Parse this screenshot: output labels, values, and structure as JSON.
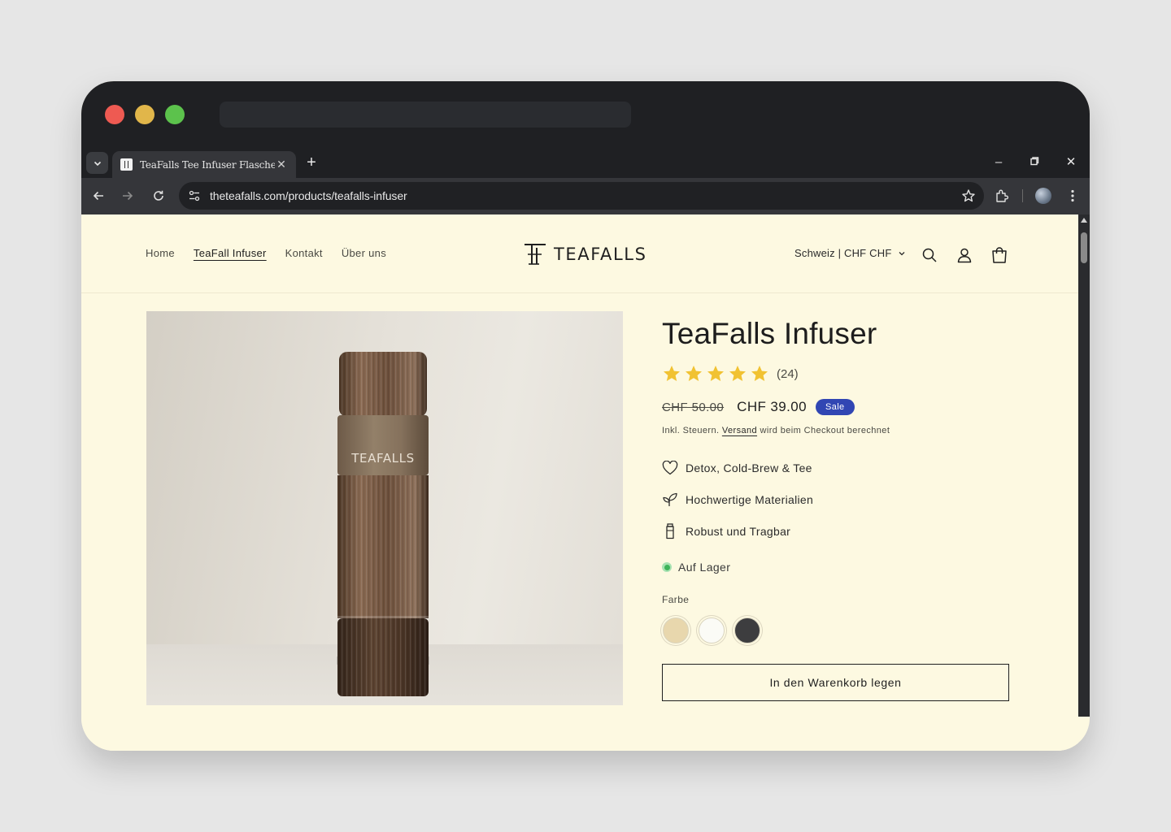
{
  "browser": {
    "tab_title": "TeaFalls Tee Infuser Flasche",
    "url": "theteafalls.com/products/teafalls-infuser"
  },
  "header": {
    "nav": [
      {
        "label": "Home"
      },
      {
        "label": "TeaFall Infuser",
        "active": true
      },
      {
        "label": "Kontakt"
      },
      {
        "label": "Über uns"
      }
    ],
    "logo_text": "TEAFALLS",
    "locale": "Schweiz | CHF CHF",
    "icons": [
      "search-icon",
      "account-icon",
      "cart-icon"
    ]
  },
  "product": {
    "image_brand": "TEAFALLS",
    "title": "TeaFalls Infuser",
    "rating": 5,
    "rating_count": "(24)",
    "old_price": "CHF 50.00",
    "price": "CHF 39.00",
    "badge": "Sale",
    "tax_prefix": "Inkl. Steuern. ",
    "tax_link": "Versand",
    "tax_suffix": " wird beim Checkout berechnet",
    "features": [
      {
        "icon": "heart-icon",
        "label": "Detox, Cold-Brew & Tee"
      },
      {
        "icon": "leaf-icon",
        "label": "Hochwertige Materialien"
      },
      {
        "icon": "bottle-icon",
        "label": "Robust und Tragbar"
      }
    ],
    "stock": "Auf Lager",
    "color_label": "Farbe",
    "colors": [
      "#e8d7ad",
      "#fbfbf6",
      "#3d3d3f"
    ],
    "cart_button": "In den Warenkorb legen"
  },
  "colors": {
    "page_bg": "#fdf9e1",
    "browser_dark": "#1f2023",
    "sale_badge": "#3146b3",
    "star": "#f1c232",
    "in_stock": "#3eb45a"
  }
}
